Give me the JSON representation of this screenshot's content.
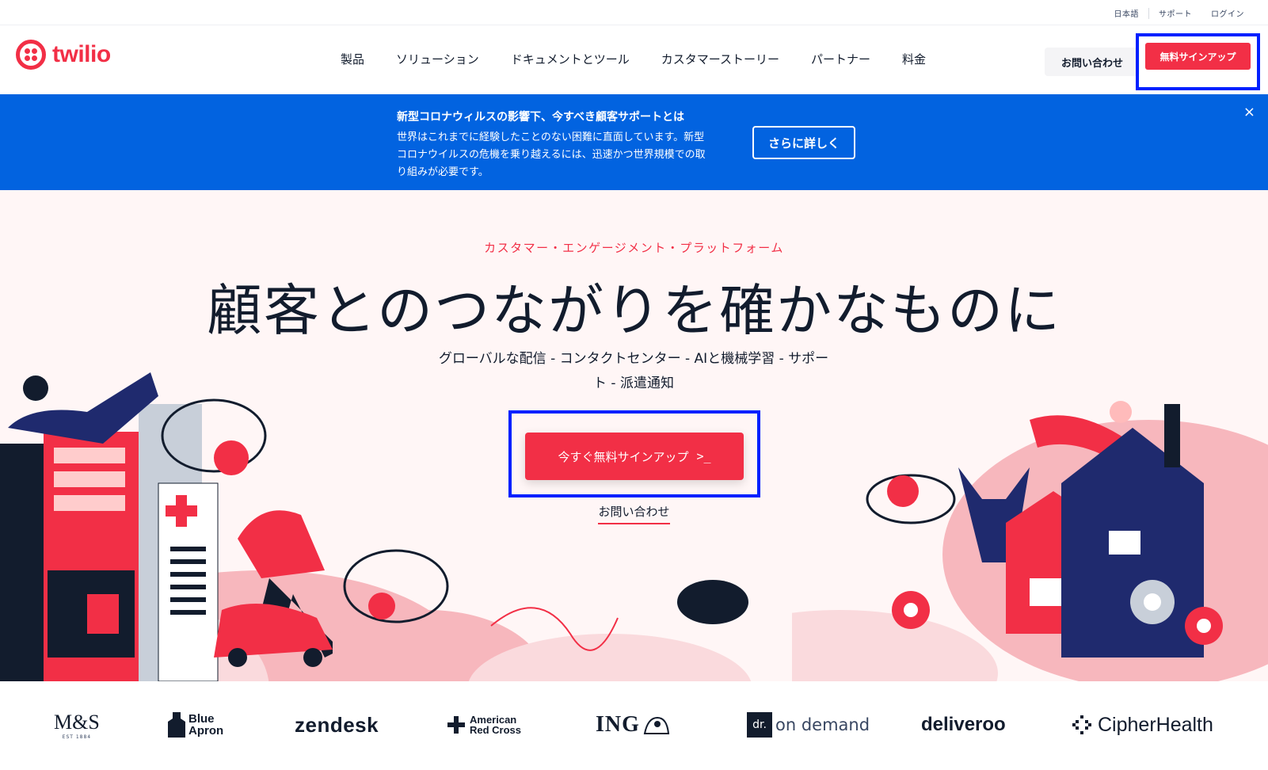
{
  "utility": {
    "links": [
      "日本語",
      "サポート",
      "ログイン"
    ]
  },
  "header": {
    "logo_text": "twilio",
    "nav": [
      "製品",
      "ソリューション",
      "ドキュメントとツール",
      "カスタマーストーリー",
      "パートナー",
      "料金"
    ],
    "contact_label": "お問い合わせ",
    "signup_label": "無料サインアップ"
  },
  "banner": {
    "title": "新型コロナウィルスの影響下、今すべき顧客サポートとは",
    "body": "世界はこれまでに経験したことのない困難に直面しています。新型コロナウイルスの危機を乗り越えるには、迅速かつ世界規模での取り組みが必要です。",
    "more_label": "さらに詳しく",
    "close_icon": "×"
  },
  "hero": {
    "eyebrow": "カスタマー・エンゲージメント・プラットフォーム",
    "headline": "顧客とのつながりを確かなものに",
    "subhead": "グローバルな配信 - コンタクトセンター - AIと機械学習 - サポート - 派遣通知",
    "cta_label": "今すぐ無料サインアップ",
    "cta_arrow": ">_",
    "contact_link": "お問い合わせ"
  },
  "logos": {
    "ms": "M&S",
    "ms_est": "EST 1884",
    "blue_apron_1": "Blue",
    "blue_apron_2": "Apron",
    "zendesk": "zendesk",
    "arc_1": "American",
    "arc_2": "Red Cross",
    "ing": "ING",
    "dr_box": "dr.",
    "dr_text": "on demand",
    "deliveroo": "deliveroo",
    "cipher": "CipherHealth"
  },
  "colors": {
    "brand_red": "#f22f46",
    "banner_blue": "#0263e0",
    "highlight_box": "#0020ff",
    "navy": "#121c2d"
  }
}
